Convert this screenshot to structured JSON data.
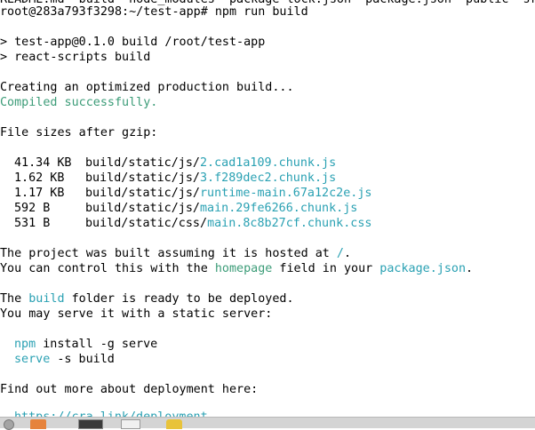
{
  "terminal": {
    "top_fragment": "README.md  build  node_modules  package-lock.json  package.json  public  src",
    "prompt": "root@283a793f3298:~/test-app# npm run build",
    "script_name_line": "> test-app@0.1.0 build /root/test-app",
    "script_cmd_line": "> react-scripts build",
    "creating": "Creating an optimized production build...",
    "compiled": "Compiled successfully.",
    "file_sizes_heading": "File sizes after gzip:",
    "files": [
      {
        "size": "41.34 KB",
        "dir": "build/static/js/",
        "name": "2.cad1a109.chunk.js"
      },
      {
        "size": "1.62 KB",
        "dir": "build/static/js/",
        "name": "3.f289dec2.chunk.js"
      },
      {
        "size": "1.17 KB",
        "dir": "build/static/js/",
        "name": "runtime-main.67a12c2e.js"
      },
      {
        "size": "592 B",
        "dir": "build/static/js/",
        "name": "main.29fe6266.chunk.js"
      },
      {
        "size": "531 B",
        "dir": "build/static/css/",
        "name": "main.8c8b27cf.chunk.css"
      }
    ],
    "hosted": {
      "text": "The project was built assuming it is hosted at ",
      "path": "/",
      "end": "."
    },
    "control": {
      "pre": "You can control this with the ",
      "field": "homepage",
      "mid": " field in your ",
      "file": "package.json",
      "end": "."
    },
    "ready": {
      "pre": "The ",
      "folder": "build",
      "post": " folder is ready to be deployed."
    },
    "serve_intro": "You may serve it with a static server:",
    "cmd1": {
      "name": "npm",
      "args": " install -g serve"
    },
    "cmd2": {
      "name": "serve",
      "args": " -s build"
    },
    "find_out": "Find out more about deployment here:",
    "deploy_link": "https://cra.link/deployment"
  },
  "colors": {
    "success": "#3c9c78",
    "highlight": "#2aa1b3",
    "background": "#ffffff",
    "text": "#000000"
  },
  "taskbar": {
    "icons": [
      "app-menu-icon",
      "file-manager-icon",
      "terminal-icon",
      "text-editor-icon",
      "notes-icon"
    ]
  }
}
